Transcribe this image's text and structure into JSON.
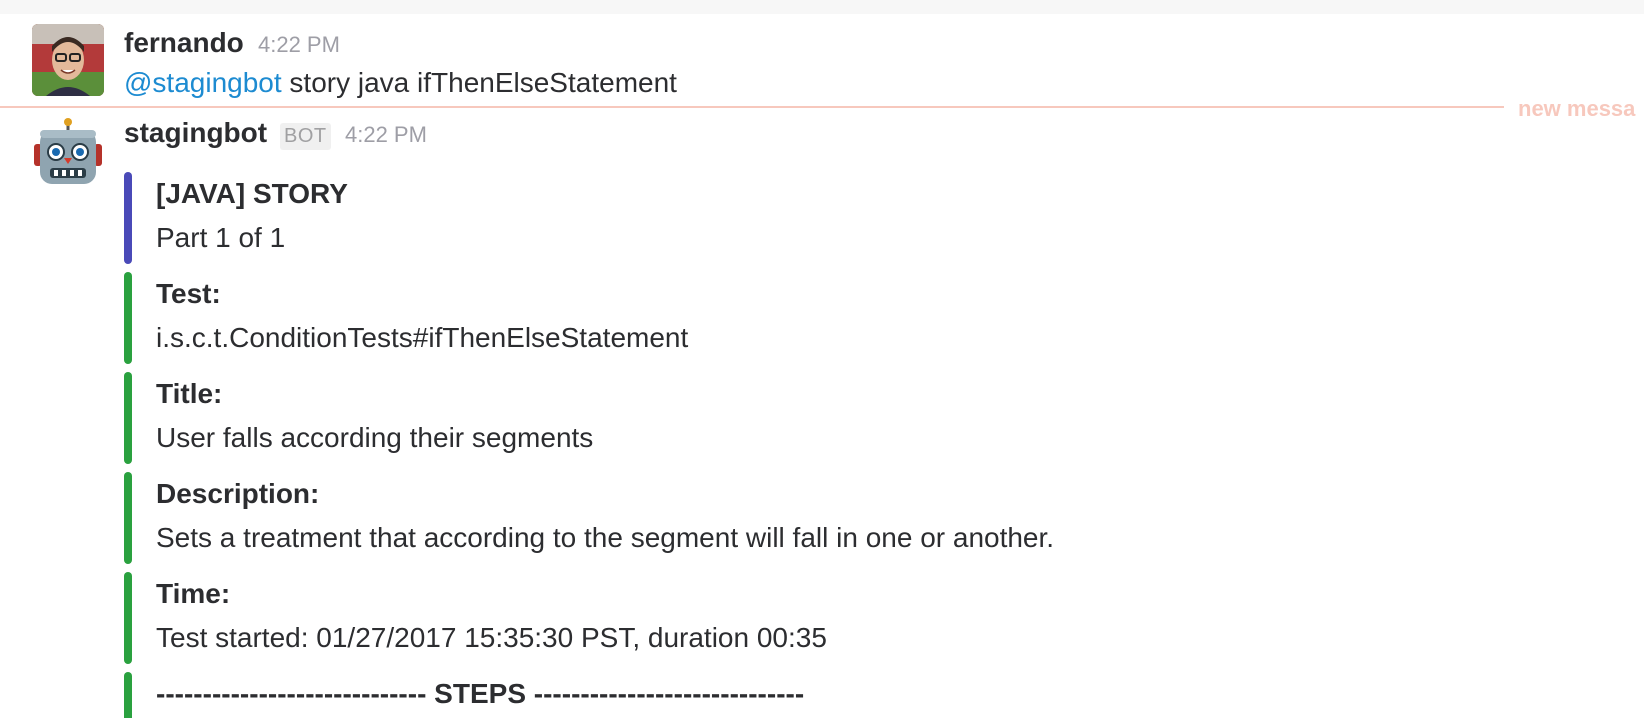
{
  "divider": {
    "label": "new messa"
  },
  "messages": [
    {
      "author": "fernando",
      "time": "4:22 PM",
      "mention": "@stagingbot",
      "text": " story java ifThenElseStatement"
    },
    {
      "author": "stagingbot",
      "badge": "BOT",
      "time": "4:22 PM"
    }
  ],
  "attachments": [
    {
      "title": "[JAVA] STORY",
      "value": "Part 1 of 1",
      "color": "#4a4ab8"
    },
    {
      "title": "Test:",
      "value": "i.s.c.t.ConditionTests#ifThenElseStatement",
      "color": "#2aa13f"
    },
    {
      "title": "Title:",
      "value": "User falls according their segments",
      "color": "#2aa13f"
    },
    {
      "title": "Description:",
      "value": "Sets a treatment that according to the segment will fall in one or another.",
      "color": "#2aa13f"
    },
    {
      "title": "Time:",
      "value": "Test started: 01/27/2017 15:35:30 PST, duration 00:35",
      "color": "#2aa13f"
    },
    {
      "title": "----------------------------- STEPS -----------------------------",
      "color": "#2aa13f"
    }
  ]
}
